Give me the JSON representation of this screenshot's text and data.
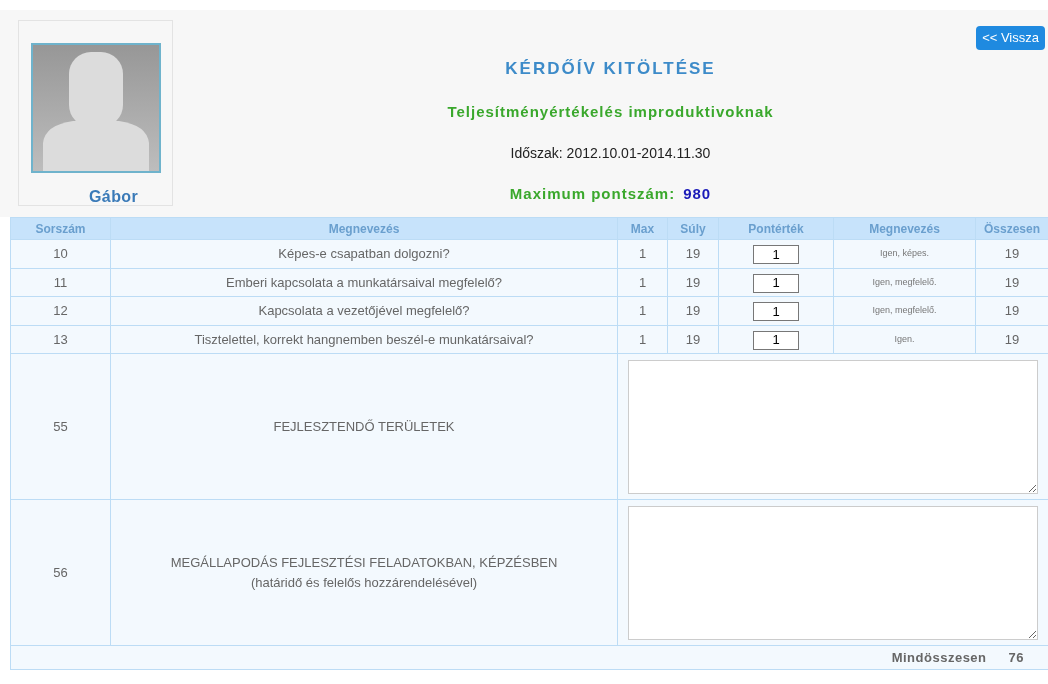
{
  "header": {
    "name": "Gábor",
    "back_button": "<< Vissza",
    "title": "KÉRDŐÍV KITÖLTÉSE",
    "subtitle": "Teljesítményértékelés improduktivoknak",
    "period": "Időszak: 2012.10.01-2014.11.30",
    "max_label": "Maximum pontszám:",
    "max_value": "980"
  },
  "table": {
    "columns": [
      "Sorszám",
      "Megnevezés",
      "Max",
      "Súly",
      "Pontérték",
      "Megnevezés",
      "Összesen"
    ],
    "rows": [
      {
        "kind": "score",
        "number": "10",
        "question": "Képes-e csapatban dolgozni?",
        "max": "1",
        "weight": "19",
        "value": "1",
        "answer": "Igen, képes.",
        "total": "19"
      },
      {
        "kind": "score",
        "number": "11",
        "question": "Emberi kapcsolata a munkatársaival megfelelő?",
        "max": "1",
        "weight": "19",
        "value": "1",
        "answer": "Igen, megfelelő.",
        "total": "19"
      },
      {
        "kind": "score",
        "number": "12",
        "question": "Kapcsolata a vezetőjével megfelelő?",
        "max": "1",
        "weight": "19",
        "value": "1",
        "answer": "Igen, megfelelő.",
        "total": "19"
      },
      {
        "kind": "score",
        "number": "13",
        "question": "Tisztelettel, korrekt hangnemben beszél-e munkatársaival?",
        "max": "1",
        "weight": "19",
        "value": "1",
        "answer": "Igen.",
        "total": "19"
      },
      {
        "kind": "text",
        "number": "55",
        "question": "FEJLESZTENDŐ TERÜLETEK"
      },
      {
        "kind": "text",
        "number": "56",
        "question": "MEGÁLLAPODÁS FEJLESZTÉSI FELADATOKBAN, KÉPZÉSBEN",
        "note": "(határidő és felelős hozzárendelésével)"
      }
    ],
    "footer": {
      "label": "Mindösszesen",
      "total": "76"
    }
  }
}
